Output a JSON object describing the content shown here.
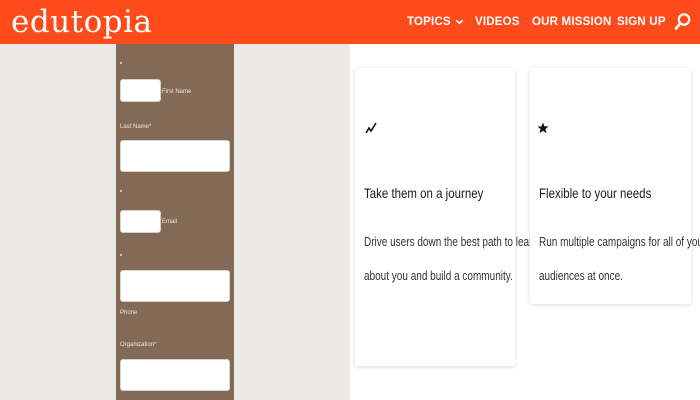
{
  "header": {
    "logo": "edutopia",
    "nav": {
      "topics": "TOPICS",
      "videos": "VIDEOS",
      "mission": "OUR MISSION",
      "signup": "SIGN UP"
    },
    "icons": [
      "chevron-down-icon",
      "search-icon"
    ],
    "color": "#ff4a1c"
  },
  "form": {
    "first_name_label": "First Name",
    "last_name_label": "Last Name*",
    "email_label": "Email",
    "phone_label": "Phone",
    "organization_label": "Organization*",
    "required_marker": "*",
    "panel_color": "#836a56"
  },
  "cards": [
    {
      "icon": "trend-icon",
      "title": "Take them on a journey",
      "body_line1": "Drive users down the best path to learn more",
      "body_line2": "about you and build a community."
    },
    {
      "icon": "star-icon",
      "title": "Flexible to your needs",
      "body_line1": "Run multiple campaigns for all of your target",
      "body_line2": "audiences at once."
    }
  ]
}
